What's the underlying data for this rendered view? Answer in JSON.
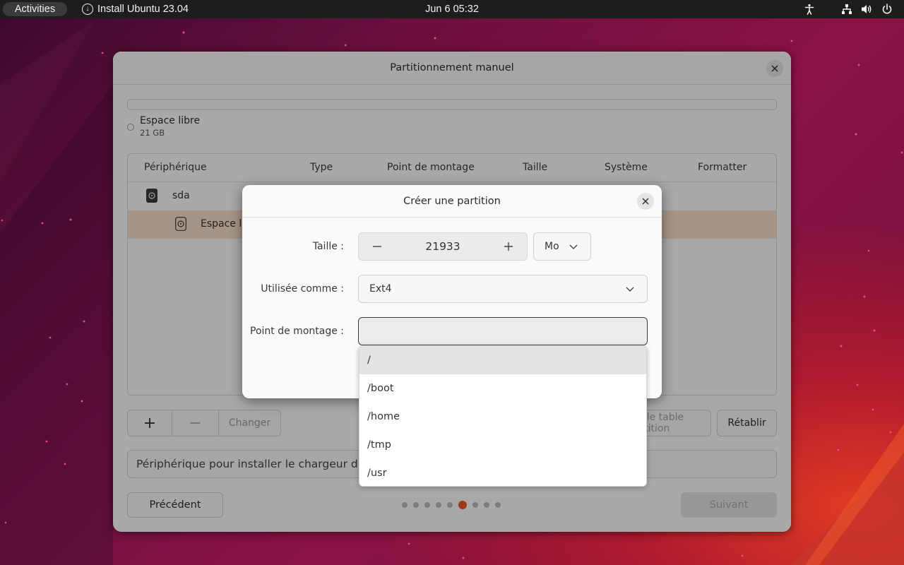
{
  "topbar": {
    "activities": "Activities",
    "app_name": "Install Ubuntu 23.04",
    "clock": "Jun 6  05:32",
    "tray_icons": [
      "accessibility-icon",
      "network-icon",
      "volume-icon",
      "power-icon"
    ]
  },
  "main_window": {
    "title": "Partitionnement manuel",
    "free_space": {
      "name": "Espace libre",
      "size": "21 GB"
    },
    "table": {
      "columns": [
        "Périphérique",
        "Type",
        "Point de montage",
        "Taille",
        "Système",
        "Formatter"
      ],
      "rows": [
        {
          "device": "sda"
        },
        {
          "device": "Espace libre"
        }
      ]
    },
    "toolbar": {
      "add": "+",
      "remove": "−",
      "change": "Changer"
    },
    "new_table_button": "Nouvelle table de partition",
    "revert_button": "Rétablir",
    "bootloader_label": "Périphérique pour installer le chargeur d'amorçage",
    "previous_button": "Précédent",
    "next_button": "Suivant",
    "pager": {
      "total": 9,
      "current": 6
    },
    "accent_color": "#E95420"
  },
  "dialog": {
    "title": "Créer une partition",
    "size_label": "Taille :",
    "size_value": "21933",
    "size_unit": "Mo",
    "use_as_label": "Utilisée comme :",
    "use_as_value": "Ext4",
    "mount_label": "Point de montage :",
    "mount_value": ""
  },
  "mount_dropdown": {
    "options": [
      "/",
      "/boot",
      "/home",
      "/tmp",
      "/usr"
    ],
    "highlighted": 0
  }
}
